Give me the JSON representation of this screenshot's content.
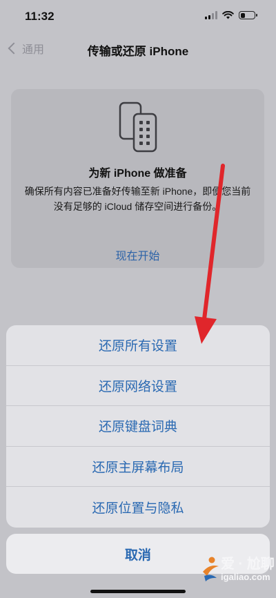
{
  "status_bar": {
    "time": "11:32",
    "battery_level": 0.35
  },
  "nav": {
    "back_label": "通用",
    "title": "传输或还原 iPhone"
  },
  "prepare": {
    "title": "为新 iPhone 做准备",
    "description": "确保所有内容已准备好传输至新 iPhone，即便您当前没有足够的 iCloud 储存空间进行备份。",
    "start_label": "现在开始"
  },
  "action_sheet": {
    "items": [
      {
        "label": "还原所有设置"
      },
      {
        "label": "还原网络设置"
      },
      {
        "label": "还原键盘词典"
      },
      {
        "label": "还原主屏幕布局"
      },
      {
        "label": "还原位置与隐私"
      }
    ],
    "cancel_label": "取消"
  },
  "watermark": {
    "name": "爱 · 尬聊",
    "url": "igaliao.com"
  },
  "colors": {
    "accent": "#2a69b2",
    "arrow": "#e0262b",
    "background": "#c3c3c8"
  }
}
